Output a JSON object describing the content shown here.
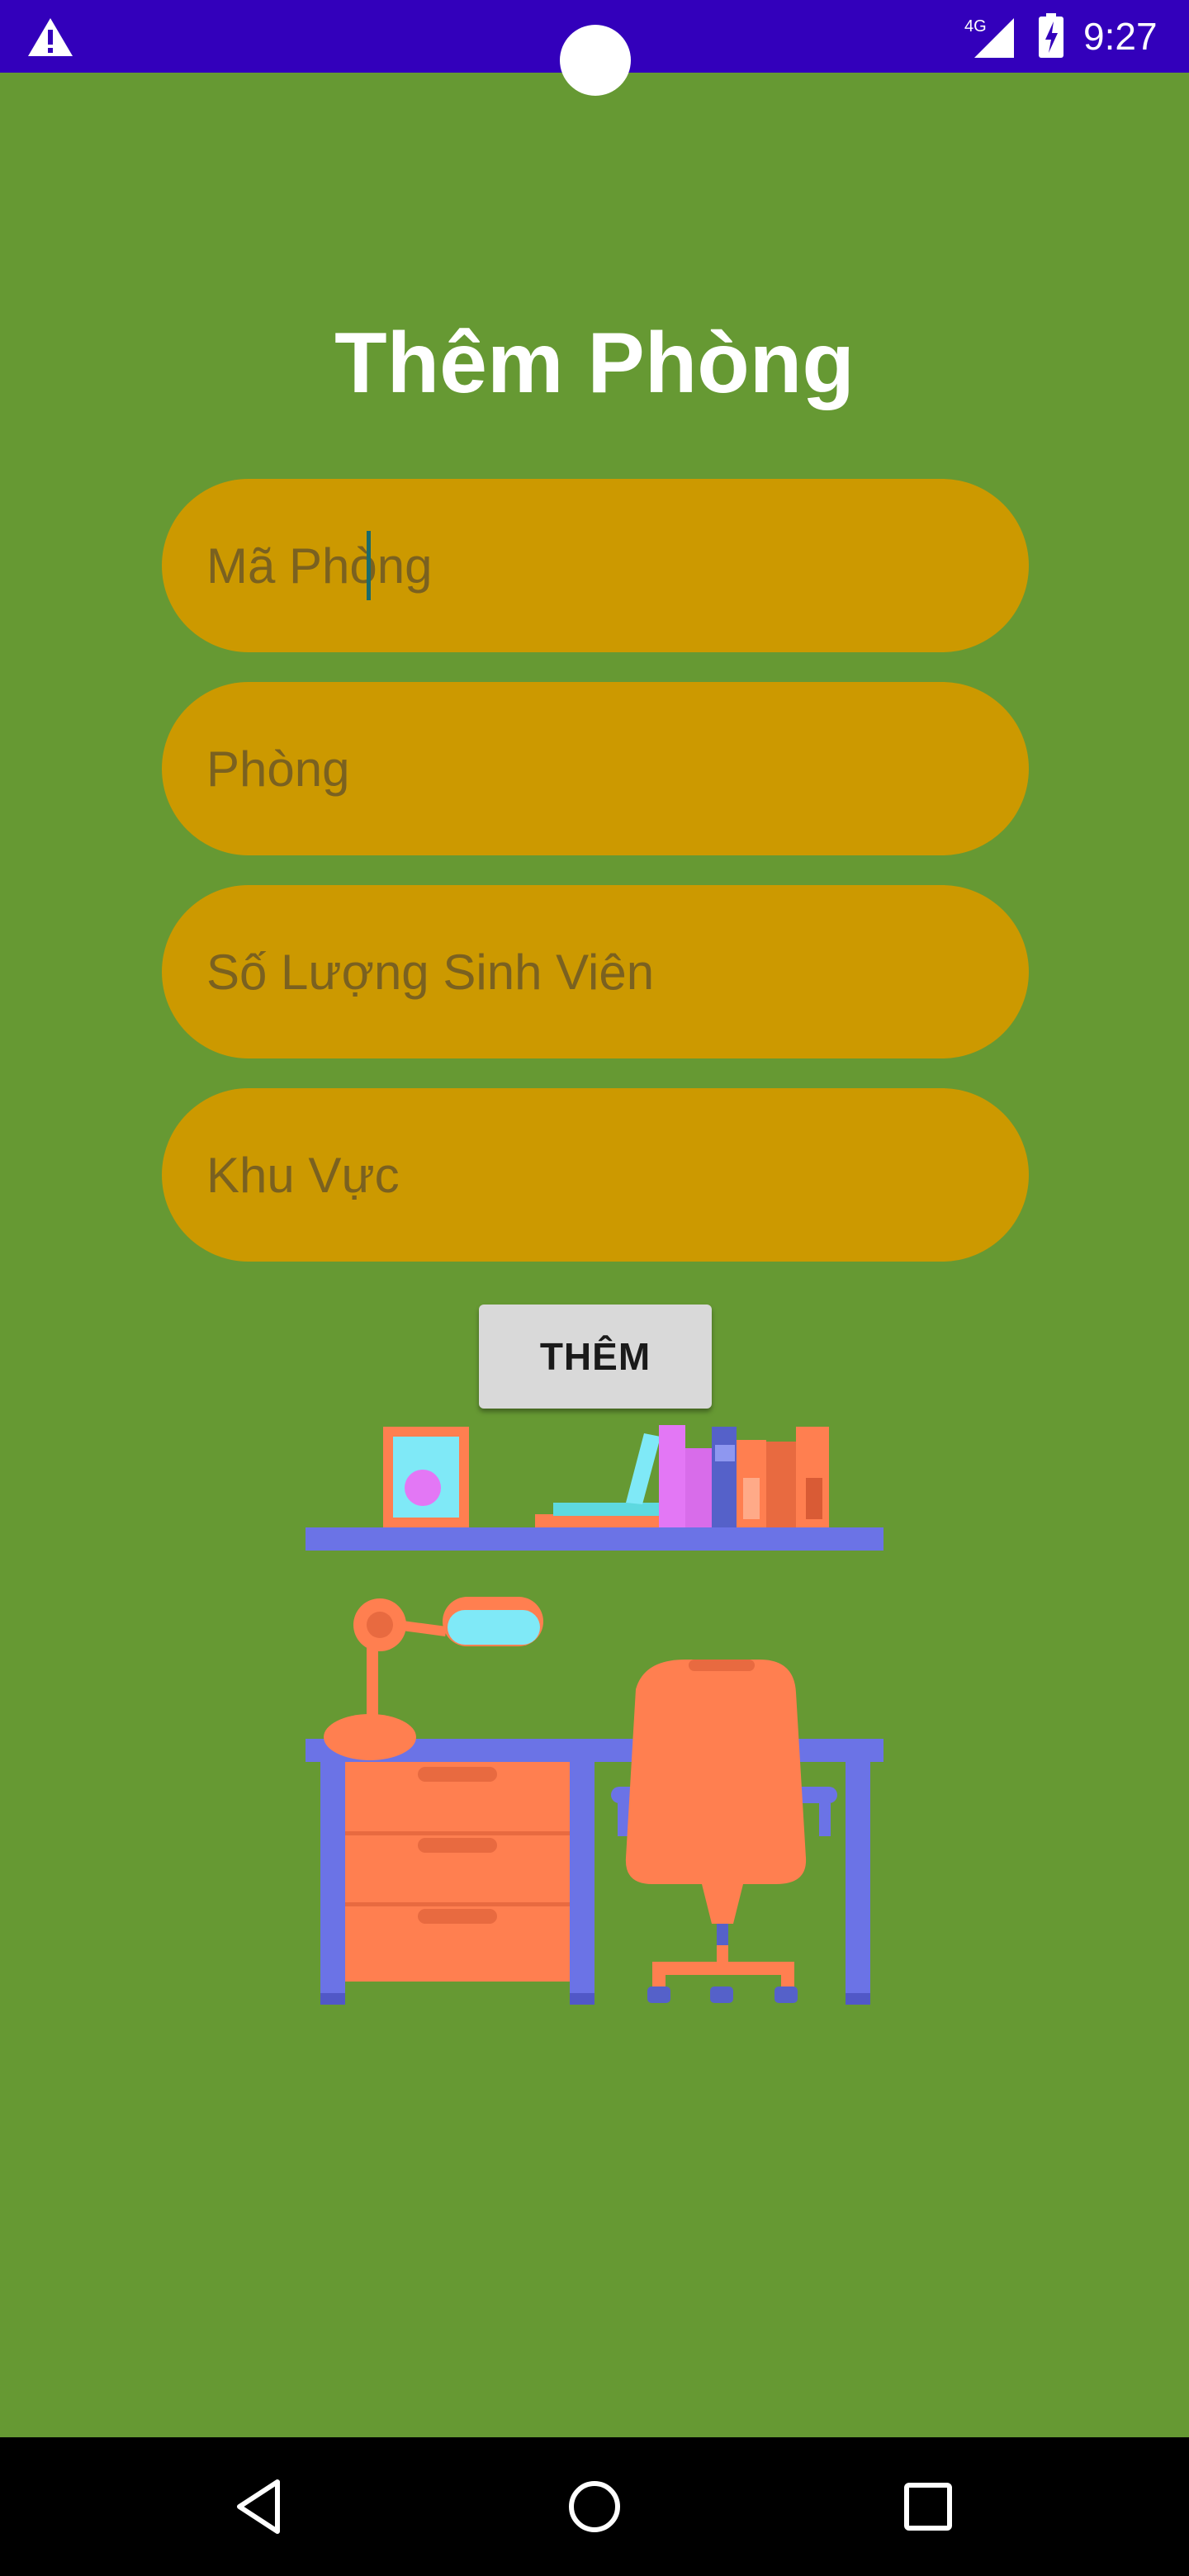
{
  "status_bar": {
    "network": "4G",
    "time": "9:27"
  },
  "page": {
    "title": "Thêm Phòng"
  },
  "form": {
    "fields": [
      {
        "placeholder": "Mã Phòng",
        "value": ""
      },
      {
        "placeholder": "Phòng",
        "value": ""
      },
      {
        "placeholder": "Số Lượng Sinh Viên",
        "value": ""
      },
      {
        "placeholder": "Khu Vực",
        "value": ""
      }
    ],
    "submit_label": "THÊM"
  },
  "colors": {
    "background": "#669933",
    "status_bar": "#3300BB",
    "field_fill": "#CC9900",
    "field_text": "#7A6120",
    "button_fill": "#D9D9D9"
  },
  "icons": [
    "warning-icon",
    "signal-4g-icon",
    "battery-charging-icon",
    "back-icon",
    "home-icon",
    "recents-icon"
  ]
}
